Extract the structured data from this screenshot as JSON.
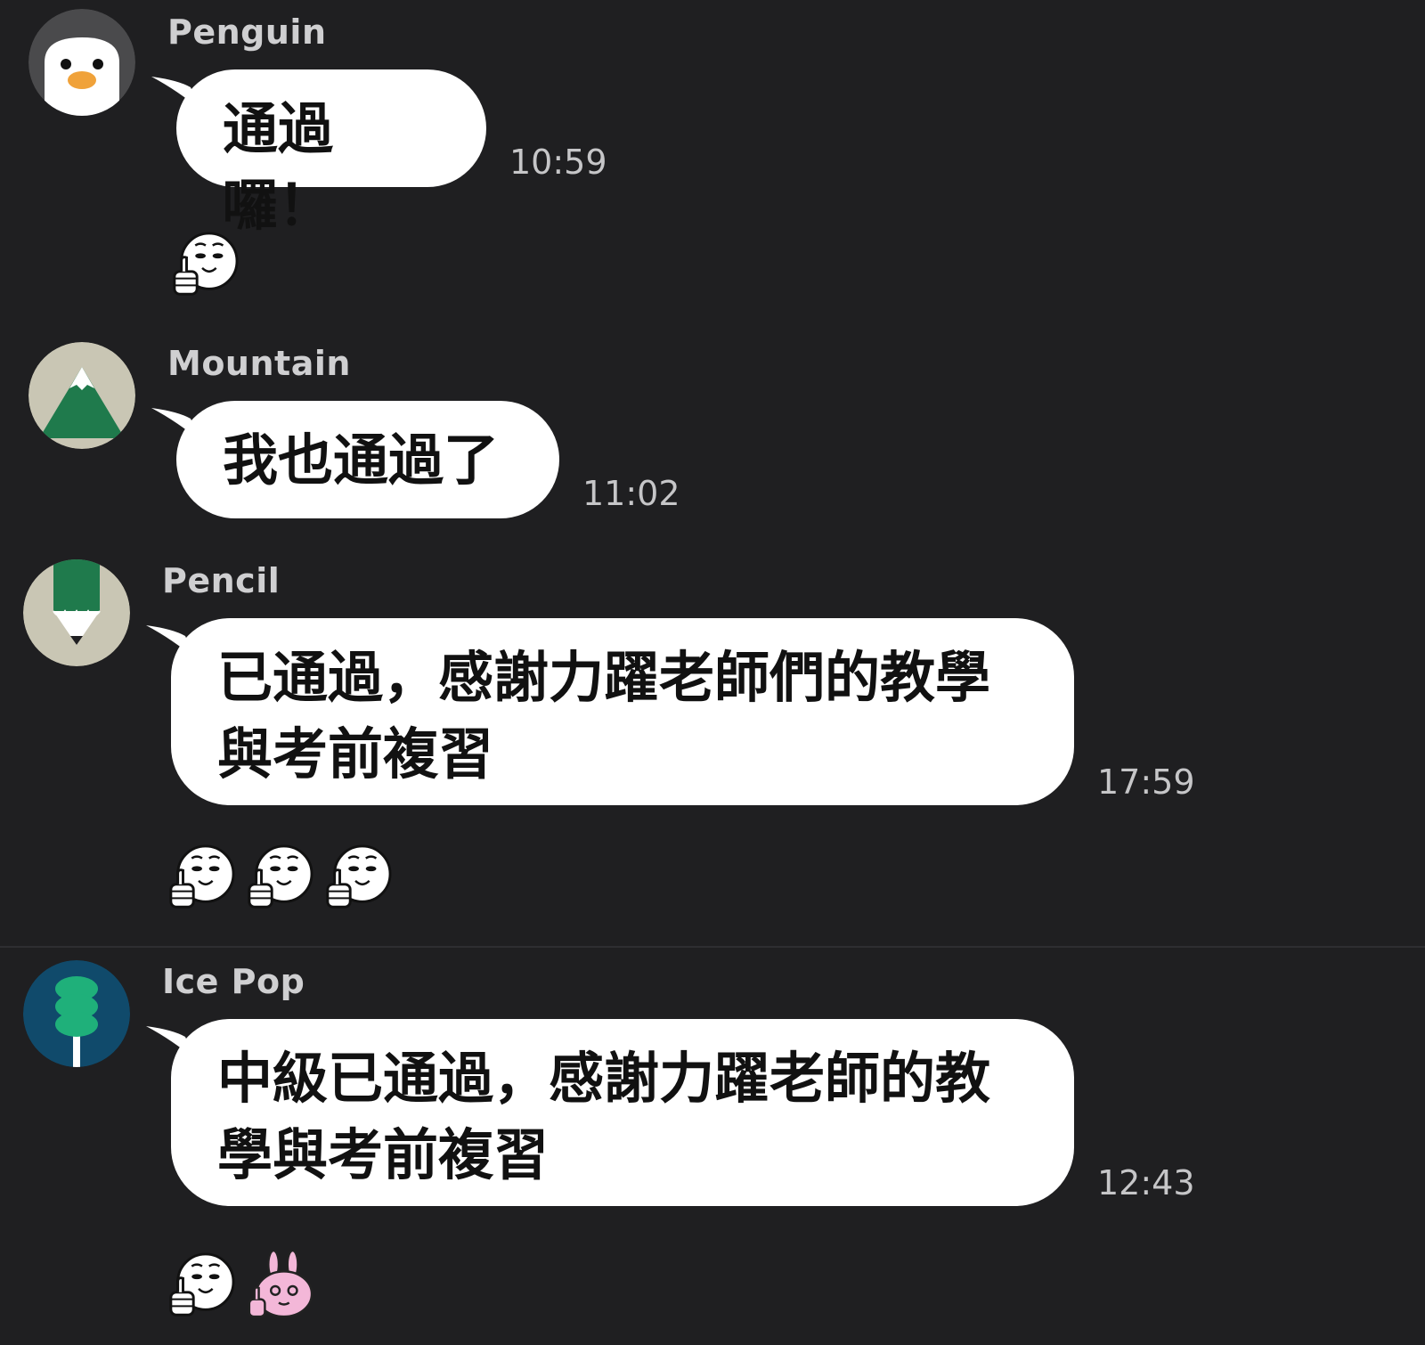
{
  "messages": [
    {
      "sender": "Penguin",
      "avatar_icon": "penguin-icon",
      "text": "通過囉！",
      "time": "10:59",
      "reactions": [
        "thumbs-up-face-icon"
      ]
    },
    {
      "sender": "Mountain",
      "avatar_icon": "mountain-icon",
      "text": "我也通過了",
      "time": "11:02",
      "reactions": []
    },
    {
      "sender": "Pencil",
      "avatar_icon": "pencil-icon",
      "text": "已通過，感謝力躍老師們的教學\n與考前複習",
      "time": "17:59",
      "reactions": [
        "thumbs-up-face-icon",
        "thumbs-up-face-icon",
        "thumbs-up-face-icon"
      ]
    },
    {
      "sender": "Ice Pop",
      "avatar_icon": "ice-pop-icon",
      "text": "中級已通過，感謝力躍老師的教\n學與考前複習",
      "time": "12:43",
      "reactions": [
        "thumbs-up-face-icon",
        "pink-bunny-thumbs-up-icon"
      ]
    }
  ],
  "colors": {
    "background": "#1f1f21",
    "bubble": "#ffffff",
    "sender_text": "#cfcfd1",
    "time_text": "#c6c6c8"
  }
}
